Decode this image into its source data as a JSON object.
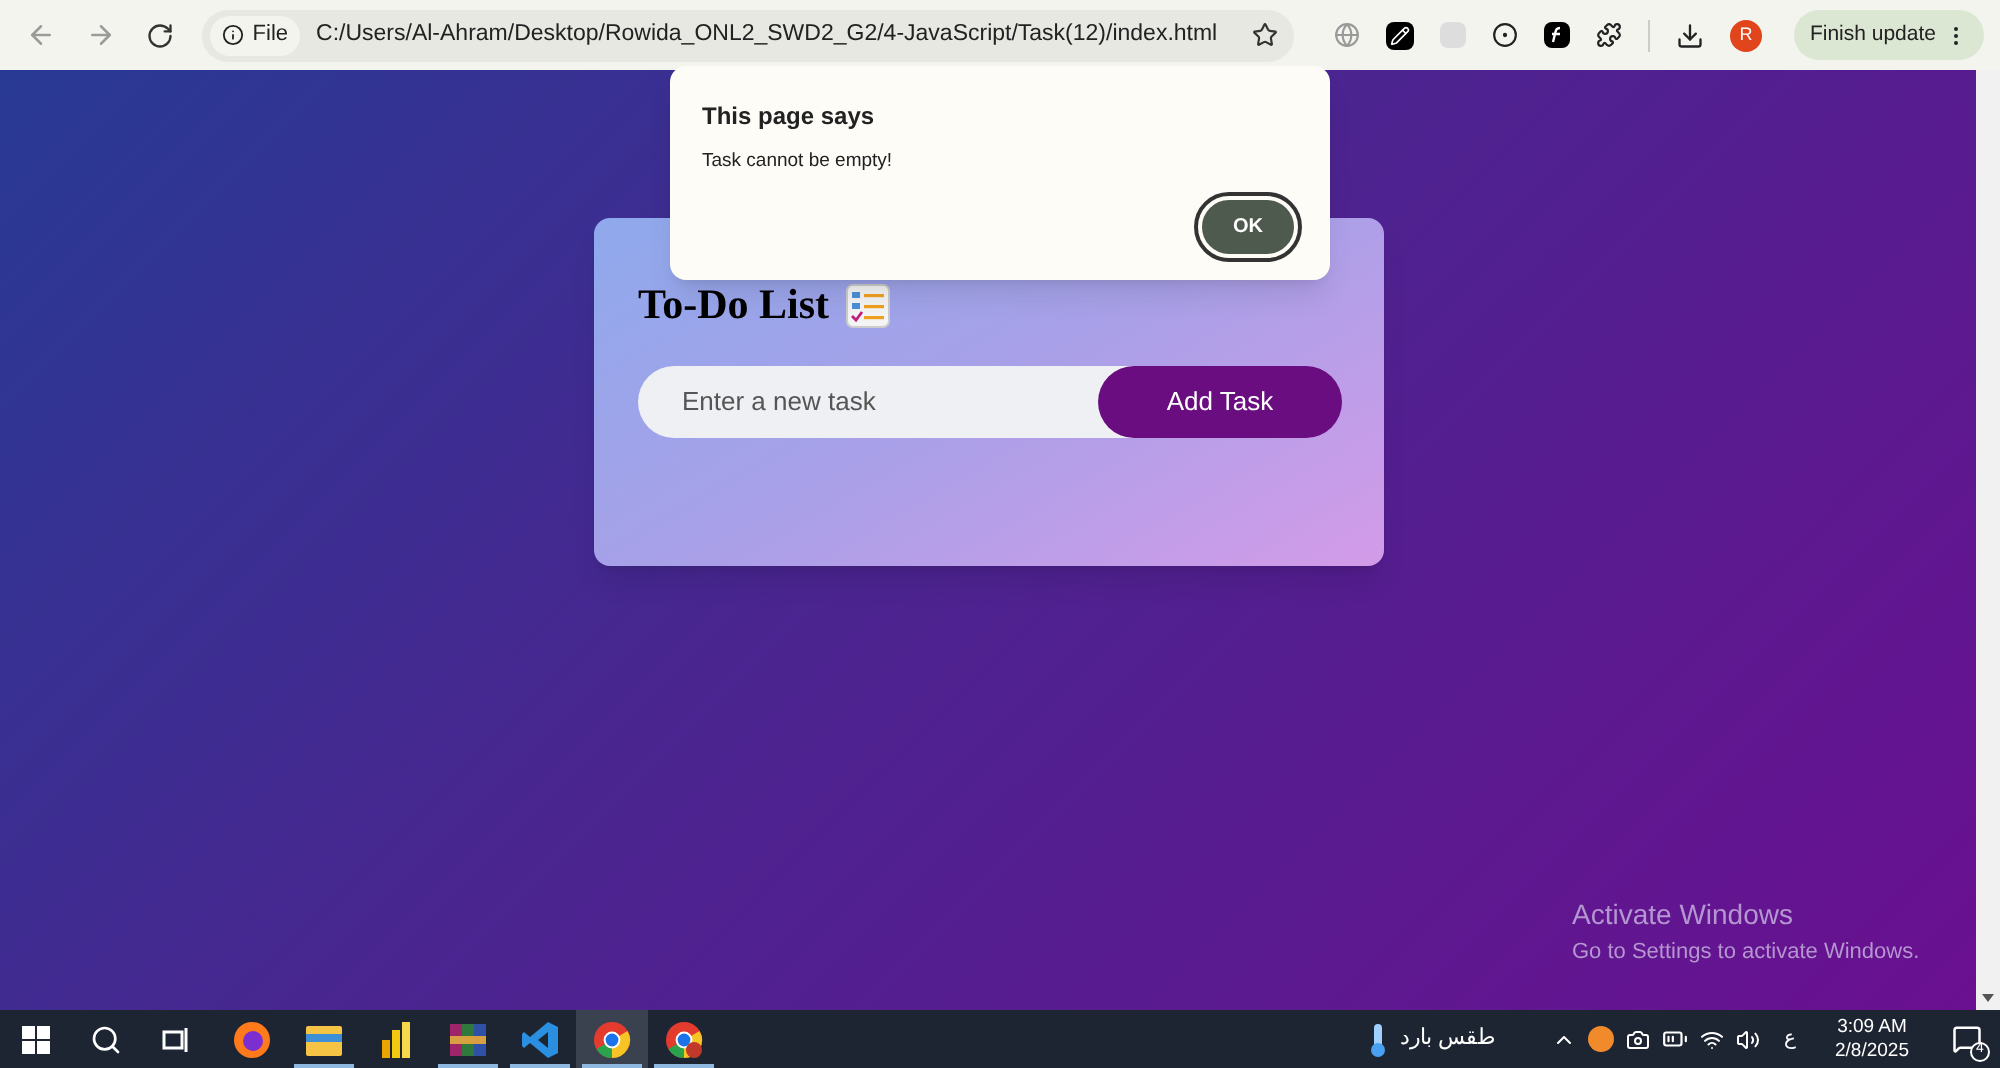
{
  "browser": {
    "scheme": "File",
    "url": "C:/Users/Al-Ahram/Desktop/Rowida_ONL2_SWD2_G2/4-JavaScript/Task(12)/index.html",
    "account_initial": "R",
    "update_button": "Finish update"
  },
  "dialog": {
    "title": "This page says",
    "message": "Task cannot be empty!",
    "button": "OK"
  },
  "todo": {
    "title": "To-Do List",
    "input": {
      "placeholder": "Enter a new task"
    },
    "button": "Add Task"
  },
  "activation_notice": {
    "title": "Activate Windows",
    "subtitle": "Go to Settings to activate Windows."
  },
  "taskbar": {
    "apps": [
      {
        "kind": "firefox",
        "running": false,
        "selected": false
      },
      {
        "kind": "folder",
        "running": true,
        "selected": false
      },
      {
        "kind": "bars",
        "running": false,
        "selected": false
      },
      {
        "kind": "archive",
        "running": true,
        "selected": false
      },
      {
        "kind": "code",
        "running": true,
        "selected": false
      },
      {
        "kind": "chrome",
        "running": true,
        "selected": true
      },
      {
        "kind": "chrome-badge",
        "running": true,
        "selected": false
      }
    ],
    "weather": "طقس بارد",
    "language": "ع",
    "time": "3:09 AM",
    "date": "2/8/2025",
    "notification_count": "4"
  }
}
